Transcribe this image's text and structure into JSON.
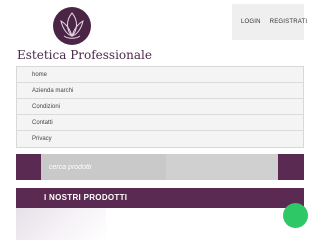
{
  "header": {
    "logo_text": "Estetica Professionale",
    "account_links": [
      "LOGIN",
      "REGISTRATI"
    ]
  },
  "nav": {
    "items": [
      "home",
      "Azienda marchi",
      "Condizioni",
      "Contatti",
      "Privacy"
    ]
  },
  "search": {
    "placeholder": "cerca prodotti"
  },
  "products": {
    "title": "I NOSTRI PRODOTTI"
  },
  "colors": {
    "brand": "#5b2a52",
    "chat": "#2ec866"
  },
  "icons": {
    "logo": "lotus-flower-icon",
    "chat": "chat-bubble-icon"
  }
}
